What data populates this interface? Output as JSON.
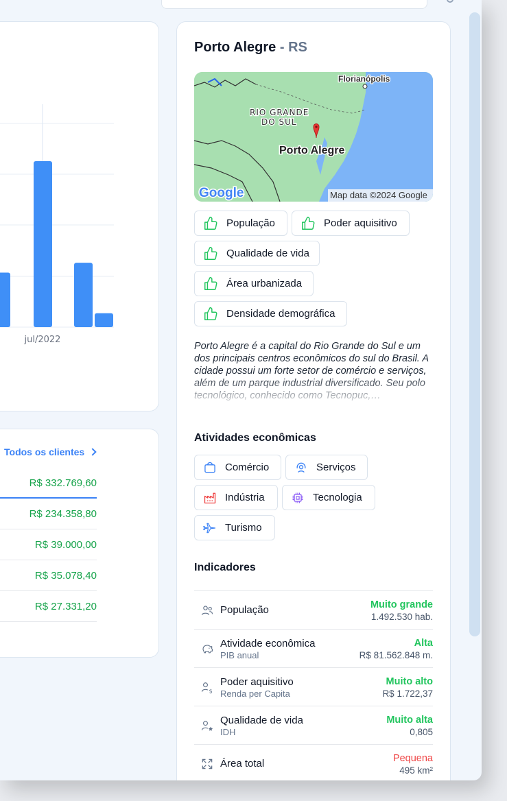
{
  "chart": {
    "x_tick_label": "jul/2022"
  },
  "chart_data": {
    "type": "bar",
    "categories": [
      "",
      "jul/2022",
      ""
    ],
    "values": [
      110,
      335,
      130
    ],
    "secondary_values": [
      null,
      null,
      28
    ],
    "xlabel": "",
    "ylabel": "",
    "grid": true
  },
  "clients": {
    "link_label": "Todos os clientes",
    "values": [
      "R$ 332.769,60",
      "R$ 234.358,80",
      "R$ 39.000,00",
      "R$ 35.078,40",
      "R$ 27.331,20"
    ]
  },
  "city": {
    "name": "Porto Alegre",
    "separator": "-",
    "state": "RS",
    "map": {
      "label_city": "Porto Alegre",
      "label_region_line1": "RIO GRANDE",
      "label_region_line2": "DO SUL",
      "label_other_city": "Florianópolis",
      "attribution": "Map data ©2024 Google",
      "logo": "Google"
    },
    "tags": [
      "População",
      "Poder aquisitivo",
      "Qualidade de vida",
      "Área urbanizada",
      "Densidade demográfica"
    ],
    "description": "Porto Alegre é a capital do Rio Grande do Sul e um dos principais centros econômicos do sul do Brasil. A cidade possui um forte setor de comércio e serviços, além de um parque industrial diversificado. Seu polo tecnológico, conhecido como Tecnopuc,…",
    "activities_title": "Atividades econômicas",
    "activities": [
      {
        "label": "Comércio",
        "icon": "bag-icon",
        "color": "#3b82f6"
      },
      {
        "label": "Serviços",
        "icon": "headset-icon",
        "color": "#3b82f6"
      },
      {
        "label": "Indústria",
        "icon": "factory-icon",
        "color": "#ef4444"
      },
      {
        "label": "Tecnologia",
        "icon": "chip-icon",
        "color": "#8b5cf6"
      },
      {
        "label": "Turismo",
        "icon": "plane-icon",
        "color": "#3b82f6"
      }
    ],
    "indicators_title": "Indicadores",
    "indicators": [
      {
        "name": "População",
        "sub": "",
        "rating": "Muito grande",
        "value": "1.492.530 hab.",
        "icon": "people-icon",
        "rating_color": "#22c55e"
      },
      {
        "name": "Atividade econômica",
        "sub": "PIB anual",
        "rating": "Alta",
        "value": "R$ 81.562.848 m.",
        "icon": "piggy-bank-icon",
        "rating_color": "#22c55e"
      },
      {
        "name": "Poder aquisitivo",
        "sub": "Renda per Capita",
        "rating": "Muito alto",
        "value": "R$ 1.722,37",
        "icon": "user-money-icon",
        "rating_color": "#22c55e"
      },
      {
        "name": "Qualidade de vida",
        "sub": "IDH",
        "rating": "Muito alta",
        "value": "0,805",
        "icon": "user-star-icon",
        "rating_color": "#22c55e"
      },
      {
        "name": "Área total",
        "sub": "",
        "rating": "Pequena",
        "value": "495 km²",
        "icon": "expand-icon",
        "rating_color": "#ef4444"
      }
    ]
  },
  "colors": {
    "accent": "#3b82f6",
    "bar": "#3f8ff7",
    "positive": "#16a34a",
    "negative": "#ef4444"
  }
}
